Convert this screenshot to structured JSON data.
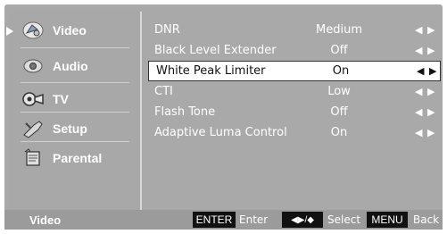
{
  "sidebar": {
    "items": [
      {
        "label": "Video",
        "icon": "video-icon",
        "active": true
      },
      {
        "label": "Audio",
        "icon": "audio-icon",
        "active": false
      },
      {
        "label": "TV",
        "icon": "tv-icon",
        "active": false
      },
      {
        "label": "Setup",
        "icon": "setup-icon",
        "active": false
      },
      {
        "label": "Parental",
        "icon": "parental-icon",
        "active": false
      }
    ]
  },
  "menu": {
    "rows": [
      {
        "label": "DNR",
        "value": "Medium",
        "arrows": "◀ ▶"
      },
      {
        "label": "Black Level Extender",
        "value": "Off",
        "arrows": "◀ ▶"
      },
      {
        "label": "White Peak Limiter",
        "value": "On",
        "arrows": "◀ ▶",
        "selected": true
      },
      {
        "label": "CTI",
        "value": "Low",
        "arrows": "◀ ▶"
      },
      {
        "label": "Flash Tone",
        "value": "Off",
        "arrows": "◀ ▶"
      },
      {
        "label": "Adaptive Luma Control",
        "value": "On",
        "arrows": "◀ ▶"
      }
    ]
  },
  "bottombar": {
    "title": "Video",
    "enter_key": "ENTER",
    "enter_desc": "Enter",
    "select_key": "◀▶/◆",
    "select_desc": "Select",
    "menu_key": "MENU",
    "menu_desc": "Back"
  },
  "colors": {
    "panel": "#a9a9a9",
    "bottom": "#9b9b9b",
    "highlight": "#ffffff",
    "key": "#111111"
  }
}
